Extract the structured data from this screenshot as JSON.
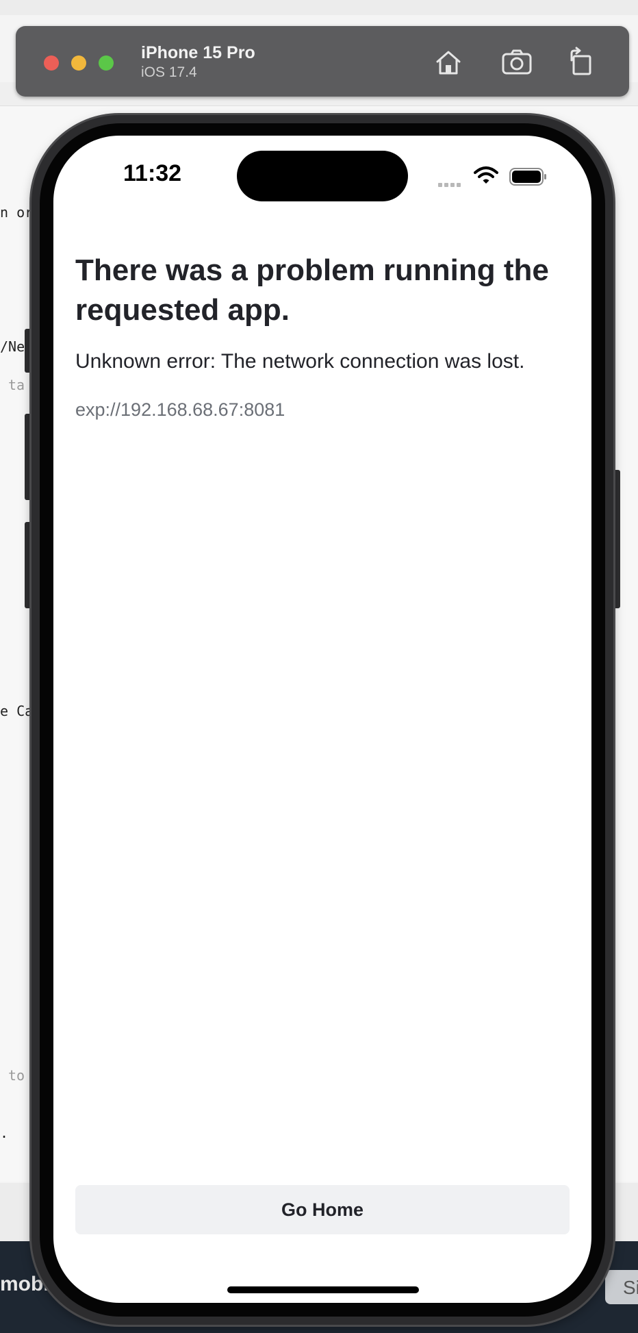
{
  "simulator": {
    "device_name": "iPhone 15 Pro",
    "os_version": "iOS 17.4",
    "toolbar_icons": [
      "home-icon",
      "screenshot-camera-icon",
      "rotate-icon"
    ]
  },
  "status_bar": {
    "time": "11:32",
    "icons": [
      "cellular-signal-icon",
      "wifi-icon",
      "battery-icon"
    ]
  },
  "error_screen": {
    "title": "There was a problem running the requested app.",
    "message": "Unknown error: The network connection was lost.",
    "url": "exp://192.168.68.67:8081",
    "go_home_label": "Go Home"
  },
  "background_editor": {
    "fragments": [
      "n or",
      "/Ne",
      "ta",
      "e Ca",
      "to",
      "."
    ],
    "terminal_text": "mobi",
    "right_button_text": "Si"
  },
  "colors": {
    "traffic_red": "#ec5f57",
    "traffic_yellow": "#f2b83c",
    "traffic_green": "#5bc748",
    "title_text": "#222329",
    "url_text": "#6b6f76",
    "button_bg": "#f0f1f3"
  }
}
